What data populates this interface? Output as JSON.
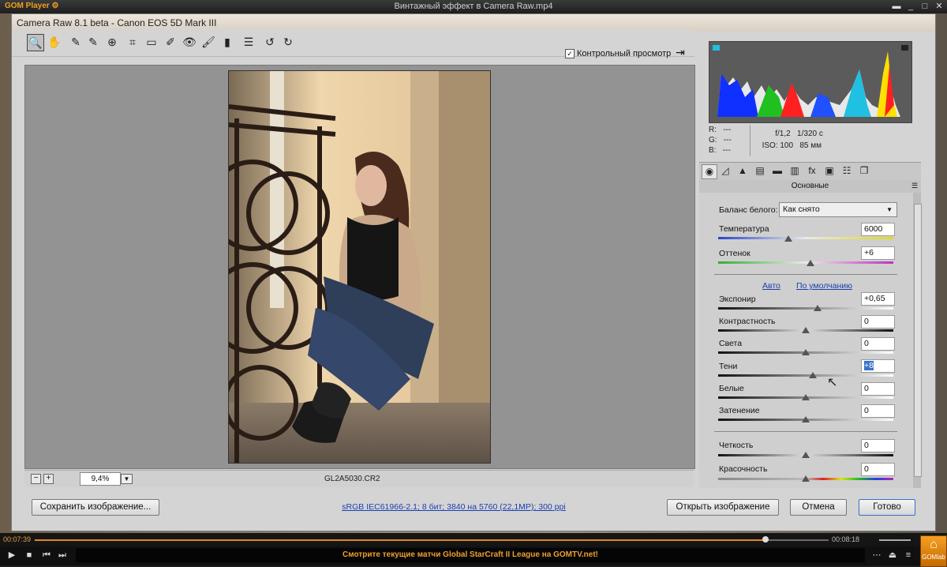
{
  "player": {
    "logo": "GOM Player ⚙",
    "title": "Винтажный эффект в Camera Raw.mp4",
    "time_current": "00:07:39",
    "time_total": "00:08:18",
    "progress": 0.92,
    "ticker": "Смотрите текущие матчи Global StarCraft II League на GOMTV.net!",
    "gomlab": "GOMlab"
  },
  "acr": {
    "title": "Camera Raw 8.1 beta  -  Canon EOS 5D Mark III",
    "toolbar": {
      "preview_label": "Контрольный просмотр",
      "preview_checked": true
    },
    "statusbar": {
      "zoom": "9,4%",
      "filename": "GL2A5030.CR2"
    },
    "info": {
      "r_label": "R:",
      "r_value": "---",
      "g_label": "G:",
      "g_value": "---",
      "b_label": "B:",
      "b_value": "---",
      "aperture": "f/1,2",
      "shutter": "1/320 с",
      "iso": "ISO: 100",
      "focal": "85 мм"
    },
    "panel": {
      "title": "Основные",
      "wb_label": "Баланс белого:",
      "wb_value": "Как снято",
      "temperature_label": "Температура",
      "temperature_value": "6000",
      "tint_label": "Оттенок",
      "tint_value": "+6",
      "auto_link": "Авто",
      "default_link": "По умолчанию",
      "exposure_label": "Экспонир",
      "exposure_value": "+0,65",
      "contrast_label": "Контрастность",
      "contrast_value": "0",
      "highlights_label": "Света",
      "highlights_value": "0",
      "shadows_label": "Тени",
      "shadows_value": "+8",
      "whites_label": "Белые",
      "whites_value": "0",
      "blacks_label": "Затенение",
      "blacks_value": "0",
      "clarity_label": "Четкость",
      "clarity_value": "0",
      "vibrance_label": "Красочность",
      "vibrance_value": "0"
    },
    "buttons": {
      "save": "Сохранить изображение...",
      "workflow": "sRGB IEC61966-2.1; 8 бит; 3840 на 5760 (22,1MP); 300 ppi",
      "open": "Открыть изображение",
      "cancel": "Отмена",
      "done": "Готово"
    }
  }
}
